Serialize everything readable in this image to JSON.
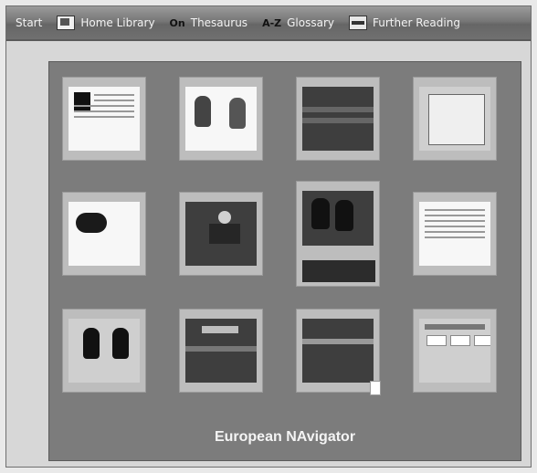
{
  "toolbar": {
    "items": [
      {
        "label": "Start",
        "icon": ""
      },
      {
        "label": "Home Library",
        "icon": "book-icon"
      },
      {
        "label": "Thesaurus",
        "icon": "thesaurus-icon",
        "icon_text": "On"
      },
      {
        "label": "Glossary",
        "icon": "glossary-icon",
        "icon_text": "A-Z"
      },
      {
        "label": "Further Reading",
        "icon": "printer-icon"
      }
    ]
  },
  "gallery": {
    "caption": "European NAvigator"
  },
  "colors": {
    "toolbar": "#777777",
    "pane": "#7c7c7c",
    "background": "#d7d7d7"
  }
}
